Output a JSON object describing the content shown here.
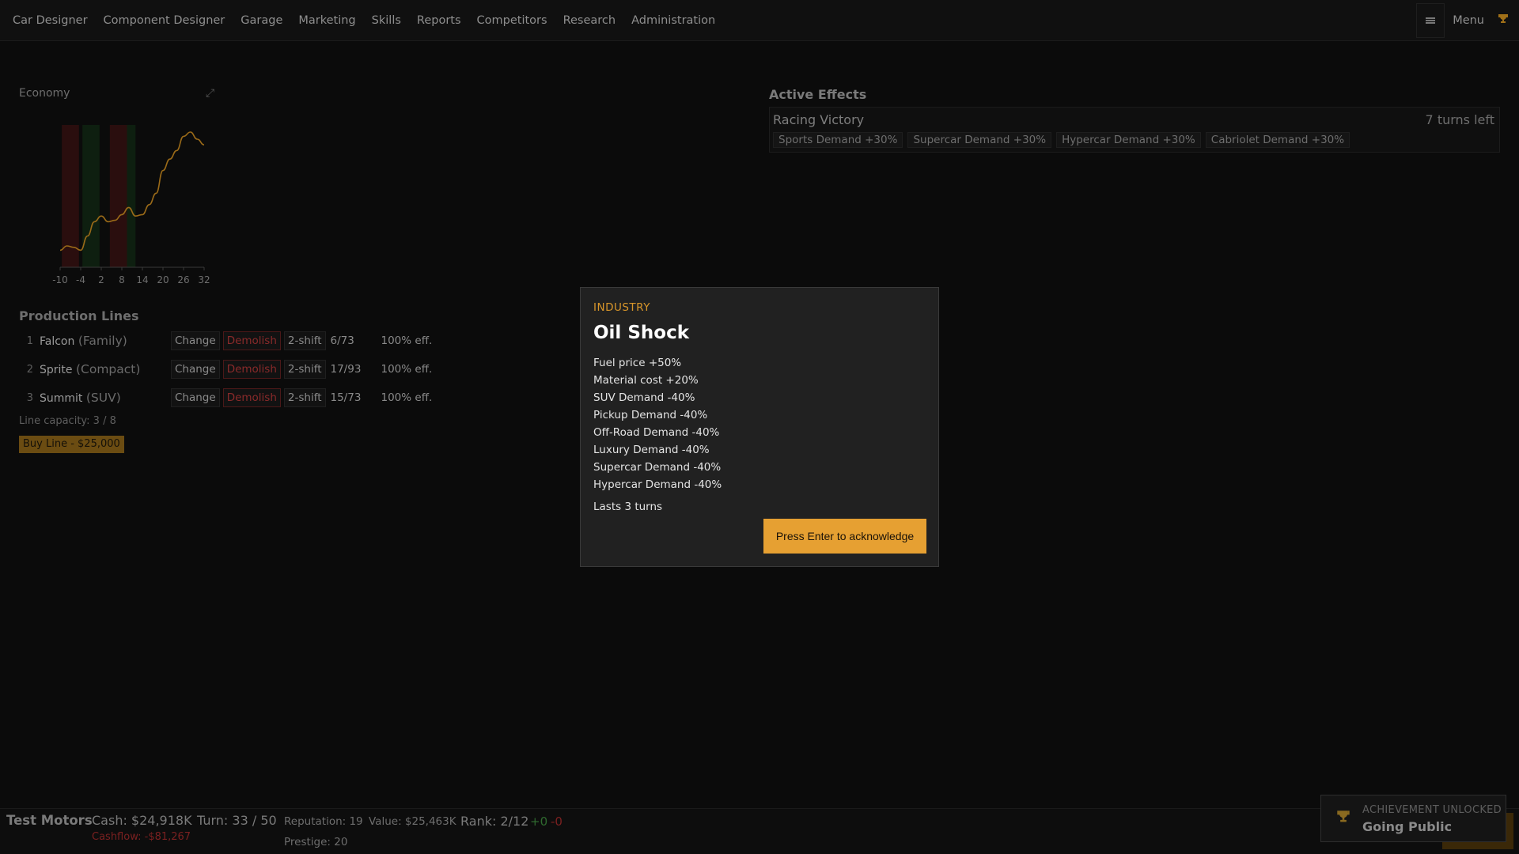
{
  "nav": {
    "items": [
      "Car Designer",
      "Component Designer",
      "Garage",
      "Marketing",
      "Skills",
      "Reports",
      "Competitors",
      "Research",
      "Administration"
    ],
    "menu_label": "Menu"
  },
  "economy": {
    "title": "Economy",
    "chart_data": {
      "type": "line",
      "title": "Economy",
      "x_ticks": [
        -10,
        -4,
        2,
        8,
        14,
        20,
        26,
        32
      ],
      "x": [
        -10,
        -8,
        -6,
        -4,
        -2,
        0,
        2,
        4,
        6,
        8,
        10,
        12,
        14,
        16,
        18,
        20,
        22,
        24,
        26,
        28,
        30,
        32
      ],
      "y": [
        0.12,
        0.15,
        0.14,
        0.12,
        0.22,
        0.32,
        0.36,
        0.32,
        0.33,
        0.37,
        0.42,
        0.36,
        0.37,
        0.44,
        0.52,
        0.68,
        0.76,
        0.82,
        0.92,
        0.95,
        0.9,
        0.86
      ],
      "ylim": [
        0,
        1
      ],
      "bands": [
        {
          "from": -9.5,
          "to": -4.5,
          "state": "recession",
          "color": "#2a0e0e"
        },
        {
          "from": -3.5,
          "to": 1.5,
          "state": "boom",
          "color": "#0e1f10"
        },
        {
          "from": 4.5,
          "to": 9.5,
          "state": "recession",
          "color": "#2a0e0e"
        },
        {
          "from": 9.5,
          "to": 12,
          "state": "boom",
          "color": "#0e1f10"
        }
      ],
      "line_color": "#9a6a18",
      "grid": false
    }
  },
  "production": {
    "title": "Production Lines",
    "lines": [
      {
        "num": "1",
        "name": "Falcon",
        "cls": "(Family)",
        "change": "Change",
        "demolish": "Demolish",
        "shift": "2-shift",
        "capacity": "6/73",
        "eff": "100% eff."
      },
      {
        "num": "2",
        "name": "Sprite",
        "cls": "(Compact)",
        "change": "Change",
        "demolish": "Demolish",
        "shift": "2-shift",
        "capacity": "17/93",
        "eff": "100% eff."
      },
      {
        "num": "3",
        "name": "Summit",
        "cls": "(SUV)",
        "change": "Change",
        "demolish": "Demolish",
        "shift": "2-shift",
        "capacity": "15/73",
        "eff": "100% eff."
      }
    ],
    "line_capacity": "Line capacity: 3 / 8",
    "buy_line": "Buy Line - $25,000"
  },
  "active_effects": {
    "title": "Active Effects",
    "effect": {
      "name": "Racing Victory",
      "turns_left": "7 turns left",
      "tags": [
        "Sports Demand +30%",
        "Supercar Demand +30%",
        "Hypercar Demand +30%",
        "Cabriolet Demand +30%"
      ]
    }
  },
  "modal": {
    "category": "INDUSTRY",
    "title": "Oil Shock",
    "effects": [
      "Fuel price +50%",
      "Material cost +20%",
      "SUV Demand -40%",
      "Pickup Demand -40%",
      "Off-Road Demand -40%",
      "Luxury Demand -40%",
      "Supercar Demand -40%",
      "Hypercar Demand -40%"
    ],
    "lasts": "Lasts 3 turns",
    "ack_label": "Press Enter to acknowledge"
  },
  "status": {
    "company": "Test Motors",
    "cash": "Cash: $24,918K",
    "cashflow": "Cashflow: -$81,267",
    "turn": "Turn: 33 / 50",
    "reputation": "Reputation: 19",
    "prestige": "Prestige: 20",
    "value": "Value: $25,463K",
    "rank": "Rank: 2/12",
    "rank_up": "+0",
    "rank_down": "-0"
  },
  "achievement": {
    "label": "ACHIEVEMENT UNLOCKED",
    "name": "Going Public"
  },
  "colors": {
    "accent": "#e6a032",
    "background": "#0b0b0b",
    "modal_bg": "#212121",
    "negative": "#7a2020",
    "positive": "#2f6a2f"
  },
  "icons": {
    "expand": "expand-icon",
    "trophy": "trophy-icon",
    "menu_toggle": "menu-bars-icon"
  }
}
